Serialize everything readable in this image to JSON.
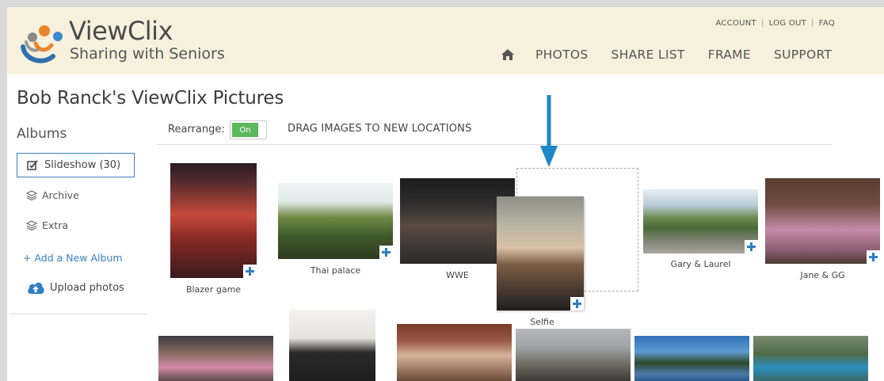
{
  "brand": {
    "name": "ViewClix",
    "tagline": "Sharing with Seniors"
  },
  "top_links": {
    "account": "ACCOUNT",
    "logout": "LOG OUT",
    "faq": "FAQ",
    "separator": "|"
  },
  "nav": {
    "home_icon": "home-icon",
    "items": [
      "PHOTOS",
      "SHARE LIST",
      "FRAME",
      "SUPPORT"
    ]
  },
  "page_title": "Bob Ranck's ViewClix Pictures",
  "sidebar": {
    "heading": "Albums",
    "slideshow": "Slideshow (30)",
    "archive": "Archive",
    "extra": "Extra",
    "add_album": "+ Add a New Album",
    "upload": "Upload photos"
  },
  "toolbar": {
    "rearrange_label": "Rearrange:",
    "toggle_state": "On",
    "drag_instructions": "DRAG IMAGES TO NEW LOCATIONS"
  },
  "photos": {
    "blazer": "Blazer game",
    "thai": "Thai palace",
    "wwe": "WWE",
    "selfie": "Selfie",
    "gary": "Gary & Laurel",
    "jane": "Jane & GG"
  },
  "colors": {
    "header_bg": "#f6f0dc",
    "accent_blue": "#2f7fc1",
    "toggle_on": "#5cb85c",
    "arrow": "#1f86c8"
  }
}
